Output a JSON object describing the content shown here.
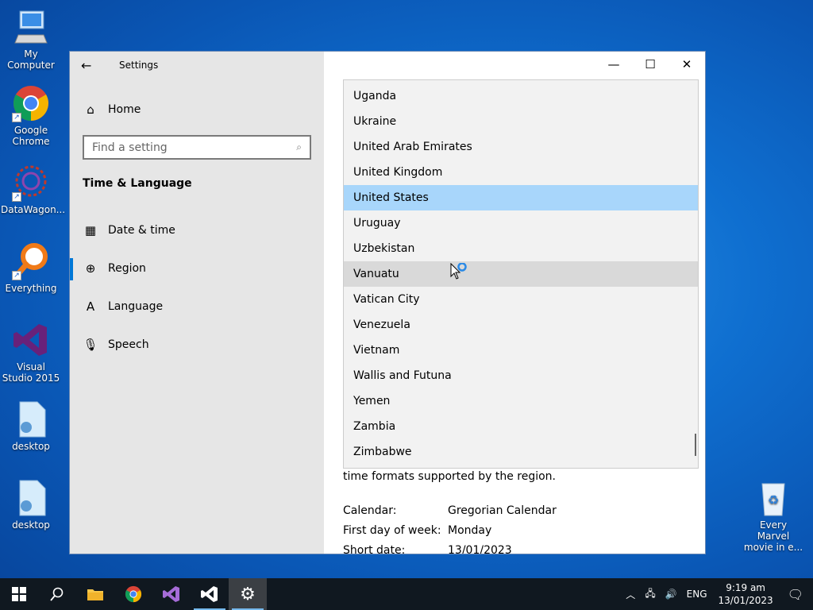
{
  "desktop": {
    "icons": [
      {
        "label": "My Computer"
      },
      {
        "label": "Google Chrome"
      },
      {
        "label": "DataWagon..."
      },
      {
        "label": "Everything"
      },
      {
        "label": "Visual Studio 2015"
      },
      {
        "label": "desktop"
      },
      {
        "label": "desktop"
      },
      {
        "label": "Every Marvel movie in e..."
      }
    ]
  },
  "window": {
    "title": "Settings",
    "home_label": "Home",
    "search_placeholder": "Find a setting",
    "section_title": "Time & Language",
    "nav": [
      {
        "label": "Date & time",
        "icon": "calendar-clock-icon"
      },
      {
        "label": "Region",
        "icon": "globe-icon"
      },
      {
        "label": "Language",
        "icon": "language-icon"
      },
      {
        "label": "Speech",
        "icon": "microphone-icon"
      }
    ],
    "accent": "#0078d7"
  },
  "dropdown": {
    "items": [
      "Uganda",
      "Ukraine",
      "United Arab Emirates",
      "United Kingdom",
      "United States",
      "Uruguay",
      "Uzbekistan",
      "Vanuatu",
      "Vatican City",
      "Venezuela",
      "Vietnam",
      "Wallis and Futuna",
      "Yemen",
      "Zambia",
      "Zimbabwe"
    ],
    "selected": "United States",
    "hovered": "Vanuatu"
  },
  "main": {
    "partial_text": "time formats supported by the region.",
    "rows": [
      {
        "key": "Calendar:",
        "value": "Gregorian Calendar"
      },
      {
        "key": "First day of week:",
        "value": "Monday"
      },
      {
        "key": "Short date:",
        "value": "13/01/2023"
      }
    ]
  },
  "taskbar": {
    "language": "ENG",
    "time": "9:19 am",
    "date": "13/01/2023"
  }
}
